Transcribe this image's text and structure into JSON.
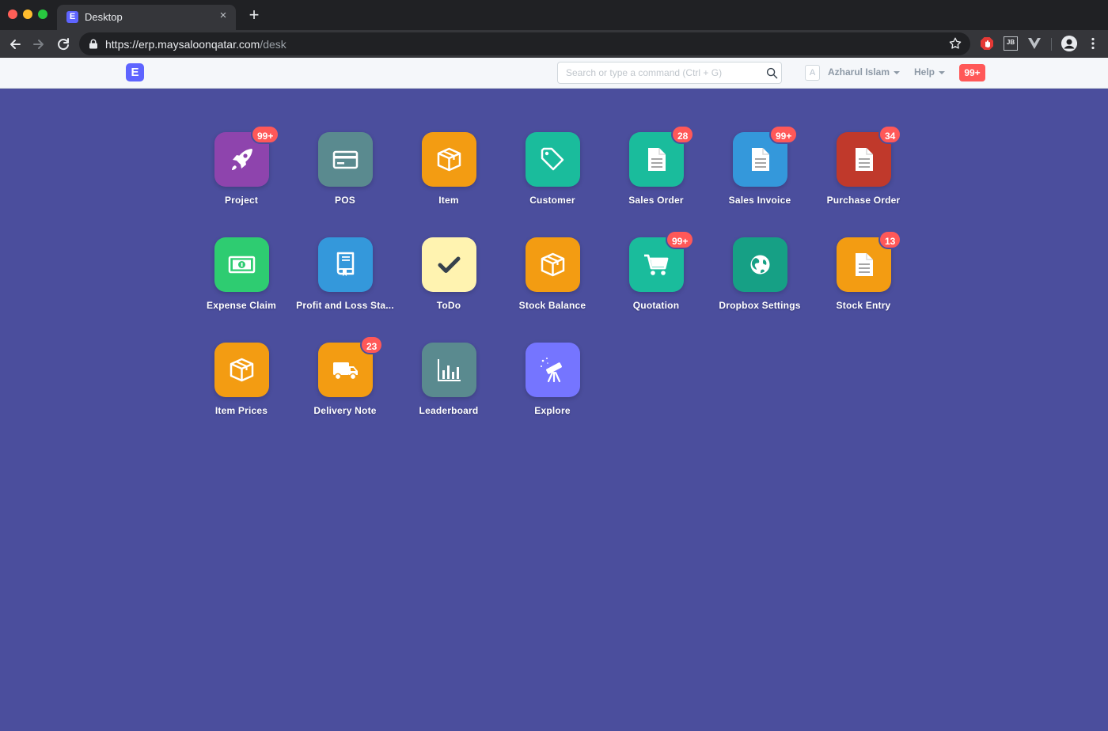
{
  "browser": {
    "tab_title": "Desktop",
    "tab_favicon_letter": "E",
    "tab_close": "×",
    "new_tab": "+",
    "url_main": "https://erp.maysaloonqatar.com",
    "url_path": "/desk",
    "extensions": [
      "adblock-icon",
      "jb-icon",
      "vue-devtools-icon",
      "profile-icon"
    ],
    "ext_jb_label": "JB"
  },
  "navbar": {
    "brand_letter": "E",
    "search_placeholder": "Search or type a command (Ctrl + G)",
    "avatar_letter": "A",
    "user_name": "Azharul Islam",
    "help_label": "Help",
    "notification_count": "99+"
  },
  "modules": [
    {
      "label": "Project",
      "icon": "rocket-icon",
      "color": "#8e44ad",
      "badge": "99+"
    },
    {
      "label": "POS",
      "icon": "credit-card-icon",
      "color": "#5a8a8f",
      "badge": ""
    },
    {
      "label": "Item",
      "icon": "box-icon",
      "color": "#f39c12",
      "badge": ""
    },
    {
      "label": "Customer",
      "icon": "tag-icon",
      "color": "#1abc9c",
      "badge": ""
    },
    {
      "label": "Sales Order",
      "icon": "document-icon",
      "color": "#1abc9c",
      "badge": "28"
    },
    {
      "label": "Sales Invoice",
      "icon": "document-icon",
      "color": "#3498db",
      "badge": "99+"
    },
    {
      "label": "Purchase Order",
      "icon": "document-icon",
      "color": "#c0392b",
      "badge": "34"
    },
    {
      "label": "Expense Claim",
      "icon": "money-icon",
      "color": "#2ecc71",
      "badge": ""
    },
    {
      "label": "Profit and Loss Sta...",
      "icon": "book-icon",
      "color": "#3498db",
      "badge": ""
    },
    {
      "label": "ToDo",
      "icon": "checkmark-icon",
      "color": "#fff3b0",
      "badge": ""
    },
    {
      "label": "Stock Balance",
      "icon": "box-icon",
      "color": "#f39c12",
      "badge": ""
    },
    {
      "label": "Quotation",
      "icon": "shopping-cart-icon",
      "color": "#1abc9c",
      "badge": "99+"
    },
    {
      "label": "Dropbox Settings",
      "icon": "globe-icon",
      "color": "#16a085",
      "badge": ""
    },
    {
      "label": "Stock Entry",
      "icon": "document-icon",
      "color": "#f39c12",
      "badge": "13"
    },
    {
      "label": "Item Prices",
      "icon": "box-icon",
      "color": "#f39c12",
      "badge": ""
    },
    {
      "label": "Delivery Note",
      "icon": "truck-icon",
      "color": "#f39c12",
      "badge": "23"
    },
    {
      "label": "Leaderboard",
      "icon": "bar-chart-icon",
      "color": "#5a8a8f",
      "badge": ""
    },
    {
      "label": "Explore",
      "icon": "telescope-icon",
      "color": "#7575ff",
      "badge": ""
    }
  ]
}
